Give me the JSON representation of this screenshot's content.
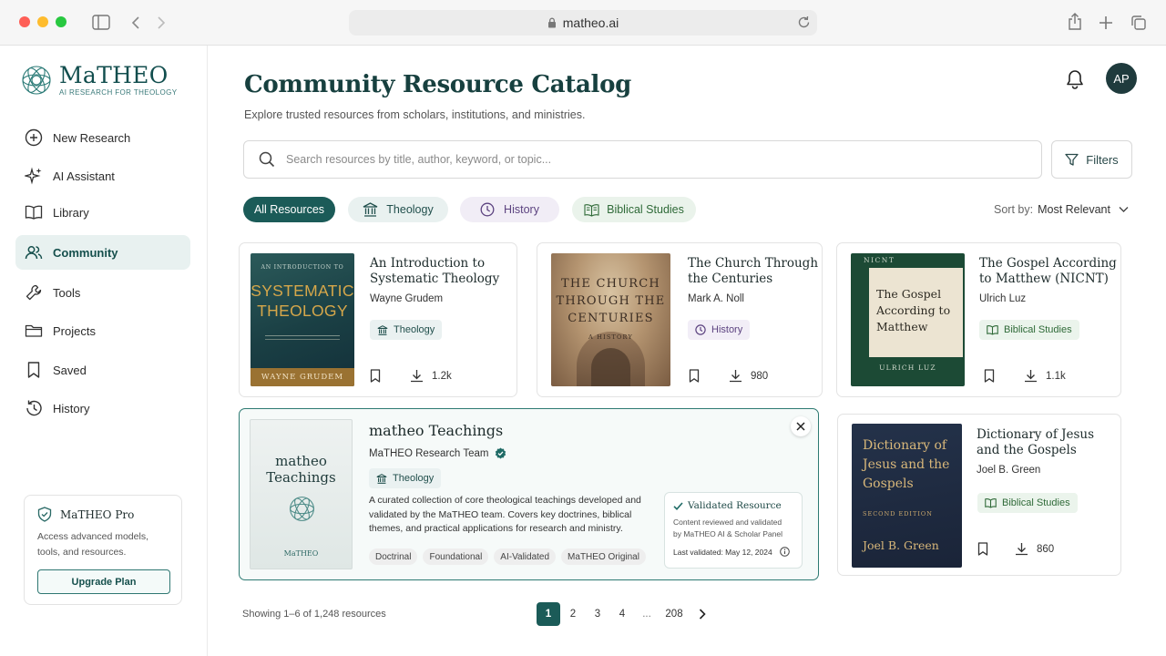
{
  "browser": {
    "url": "matheo.ai"
  },
  "brand": {
    "name": "MaTHEO",
    "tagline": "AI RESEARCH FOR THEOLOGY"
  },
  "nav": [
    {
      "label": "New Research",
      "icon": "plus-circle-icon"
    },
    {
      "label": "AI Assistant",
      "icon": "sparkle-icon"
    },
    {
      "label": "Library",
      "icon": "book-open-icon"
    },
    {
      "label": "Community",
      "icon": "users-icon",
      "active": true
    },
    {
      "label": "Tools",
      "icon": "wrench-icon"
    },
    {
      "label": "Projects",
      "icon": "folder-icon"
    },
    {
      "label": "Saved",
      "icon": "bookmark-icon"
    },
    {
      "label": "History",
      "icon": "history-icon"
    }
  ],
  "pro": {
    "title": "MaTHEO Pro",
    "desc1": "Access advanced models,",
    "desc2": "tools, and resources.",
    "button": "Upgrade Plan"
  },
  "page": {
    "title": "Community Resource Catalog",
    "subtitle": "Explore trusted resources from scholars, institutions, and ministries."
  },
  "user": {
    "initials": "AP"
  },
  "search": {
    "placeholder": "Search resources by title, author, keyword, or topic...",
    "filters": "Filters"
  },
  "chips": [
    "All Resources",
    "Theology",
    "History",
    "Biblical Studies"
  ],
  "sort": {
    "label": "Sort by:",
    "value": "Most Relevant"
  },
  "cards": [
    {
      "title1": "An Introduction to",
      "title2": "Systematic Theology",
      "author": "Wayne Grudem",
      "tag": "Theology",
      "downloads": "1.2k",
      "cover": {
        "top": "AN INTRODUCTION TO",
        "main1": "SYSTEMATIC",
        "main2": "THEOLOGY",
        "author": "WAYNE GRUDEM"
      }
    },
    {
      "title1": "The Church Through",
      "title2": "the Centuries",
      "author": "Mark A. Noll",
      "tag": "History",
      "downloads": "980",
      "cover": {
        "main1": "THE CHURCH",
        "main2": "THROUGH THE",
        "main3": "CENTURIES",
        "sub": "A HISTORY"
      }
    },
    {
      "title1": "The Gospel According",
      "title2": "to Matthew (NICNT)",
      "author": "Ulrich Luz",
      "tag": "Biblical Studies",
      "downloads": "1.1k",
      "cover": {
        "top": "NICNT",
        "main1": "The Gospel",
        "main2": "According to",
        "main3": "Matthew",
        "author": "ULRICH LUZ"
      }
    },
    {
      "title": "matheo Teachings",
      "author": "MaTHEO Research Team",
      "tag": "Theology",
      "desc1": "A curated collection of core theological teachings developed and",
      "desc2": "validated by the MaTHEO team. Covers key doctrines, biblical",
      "desc3": "themes, and practical applications for research and ministry.",
      "pills": [
        "Doctrinal",
        "Foundational",
        "AI-Validated",
        "MaTHEO Original"
      ],
      "validated": {
        "title": "Validated Resource",
        "line1": "Content reviewed and validated",
        "line2": "by MaTHEO AI & Scholar Panel",
        "date": "Last validated: May 12, 2024"
      },
      "cover": {
        "main1": "matheo",
        "main2": "Teachings",
        "brand": "MaTHEO"
      }
    },
    {
      "title1": "Dictionary of Jesus",
      "title2": "and the Gospels",
      "author": "Joel B. Green",
      "tag": "Biblical Studies",
      "downloads": "860",
      "cover": {
        "main1": "Dictionary of",
        "main2": "Jesus and the",
        "main3": "Gospels",
        "edition": "SECOND EDITION",
        "author": "Joel B. Green"
      }
    }
  ],
  "footer": {
    "showing": "Showing 1–6 of 1,248 resources",
    "pages": [
      "1",
      "2",
      "3",
      "4",
      "...",
      "208"
    ]
  },
  "colors": {
    "brand": "#124e4e",
    "accent": "#1f6b66",
    "active_bg": "#e8f1f0"
  }
}
